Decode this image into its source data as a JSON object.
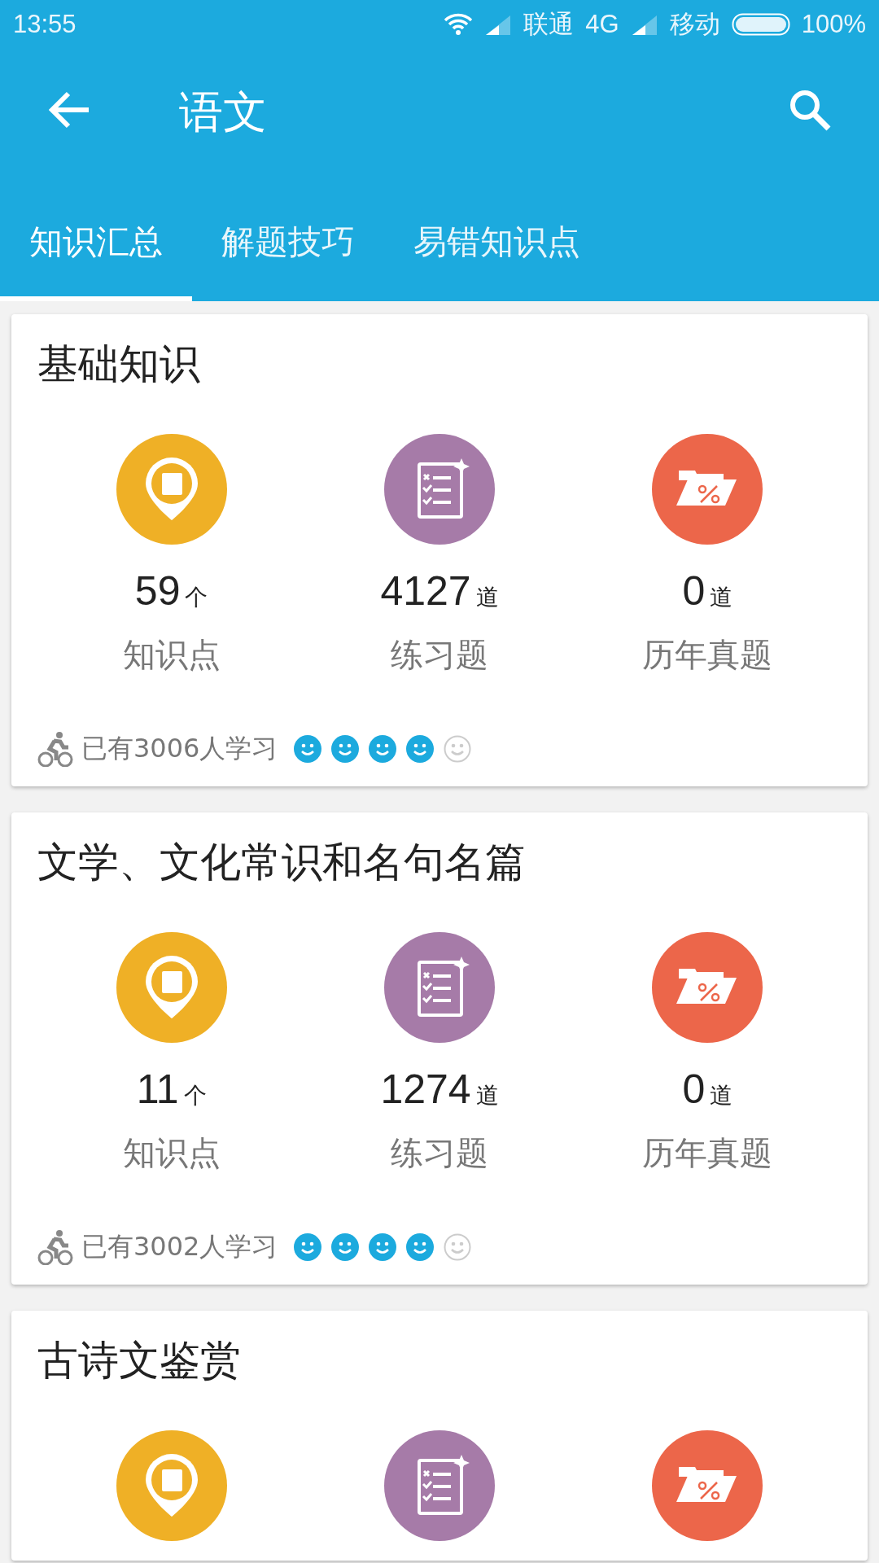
{
  "status_bar": {
    "time": "13:55",
    "carrier_1": "联通",
    "network_1": "4G",
    "carrier_2": "移动",
    "battery": "100%"
  },
  "app_bar": {
    "title": "语文"
  },
  "tabs": [
    {
      "label": "知识汇总",
      "selected": true
    },
    {
      "label": "解题技巧",
      "selected": false
    },
    {
      "label": "易错知识点",
      "selected": false
    }
  ],
  "cards": [
    {
      "title": "基础知识",
      "stats": [
        {
          "kind": "points",
          "count": "59",
          "unit": "个",
          "label": "知识点"
        },
        {
          "kind": "exercises",
          "count": "4127",
          "unit": "道",
          "label": "练习题"
        },
        {
          "kind": "exams",
          "count": "0",
          "unit": "道",
          "label": "历年真题"
        }
      ],
      "learners": "已有3006人学习",
      "stars": 4
    },
    {
      "title": "文学、文化常识和名句名篇",
      "stats": [
        {
          "kind": "points",
          "count": "11",
          "unit": "个",
          "label": "知识点"
        },
        {
          "kind": "exercises",
          "count": "1274",
          "unit": "道",
          "label": "练习题"
        },
        {
          "kind": "exams",
          "count": "0",
          "unit": "道",
          "label": "历年真题"
        }
      ],
      "learners": "已有3002人学习",
      "stars": 4
    },
    {
      "title": "古诗文鉴赏",
      "stats": [
        {
          "kind": "points"
        },
        {
          "kind": "exercises"
        },
        {
          "kind": "exams"
        }
      ]
    }
  ]
}
